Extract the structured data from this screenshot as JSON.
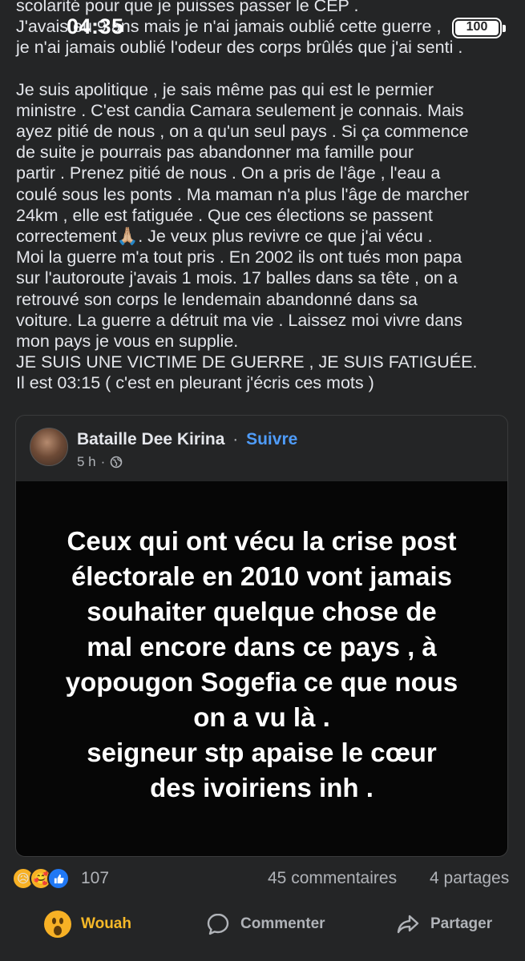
{
  "status_bar": {
    "time": "04:35",
    "battery": "100"
  },
  "post": {
    "paragraph1": [
      "scolarité pour que je puisses passer le CEP .",
      "J'avais eu 9 ans mais je n'ai jamais oublié cette guerre ,",
      "je n'ai jamais oublié l'odeur des corps brûlés que j'ai senti ."
    ],
    "paragraph2": [
      "Je suis apolitique , je sais même pas qui est le permier",
      "ministre . C'est candia Camara seulement je connais. Mais",
      "ayez pitié de nous , on a qu'un seul pays . Si ça commence",
      "de suite je pourrais pas abandonner ma famille pour",
      "partir . Prenez pitié de nous . On a pris de l'âge , l'eau a",
      "coulé sous les ponts . Ma maman n'a plus l'âge de marcher",
      "24km , elle est fatiguée . Que ces élections se passent",
      "correctement🙏🏼. Je veux plus revivre ce que j'ai vécu .",
      "Moi la guerre m'a tout pris . En 2002 ils ont tués mon papa",
      "sur l'autoroute j'avais 1 mois.  17 balles dans sa tête , on a",
      "retrouvé son corps le lendemain abandonné dans sa",
      "voiture. La guerre a détruit ma vie . Laissez moi vivre dans",
      "mon pays je vous en supplie.",
      "JE SUIS UNE VICTIME DE GUERRE , JE SUIS FATIGUÉE.",
      "Il est 03:15 ( c'est en pleurant j'écris ces mots )"
    ]
  },
  "shared_post": {
    "author": "Bataille Dee Kirina",
    "separator": "·",
    "follow_label": "Suivre",
    "time": "5 h",
    "meta_separator": "·",
    "audience_icon": "globe-icon",
    "image_text": [
      "Ceux qui ont vécu la crise post",
      "électorale en 2010 vont jamais",
      "souhaiter quelque chose de",
      "mal  encore dans ce pays , à",
      "yopougon  Sogefia ce que nous",
      "on a vu là .",
      "seigneur stp  apaise le cœur",
      "des ivoiriens inh ."
    ]
  },
  "reactions": {
    "icons": [
      "sad-reaction-icon",
      "care-reaction-icon",
      "like-reaction-icon"
    ],
    "count": "107",
    "comments": "45 commentaires",
    "shares": "4 partages"
  },
  "actions": {
    "wouah": "Wouah",
    "comment": "Commenter",
    "share": "Partager"
  },
  "colors": {
    "background": "#242526",
    "text": "#e4e6eb",
    "muted": "#b0b3b8",
    "link": "#4f9cf9",
    "wow": "#f7b928",
    "like": "#2078f4"
  }
}
